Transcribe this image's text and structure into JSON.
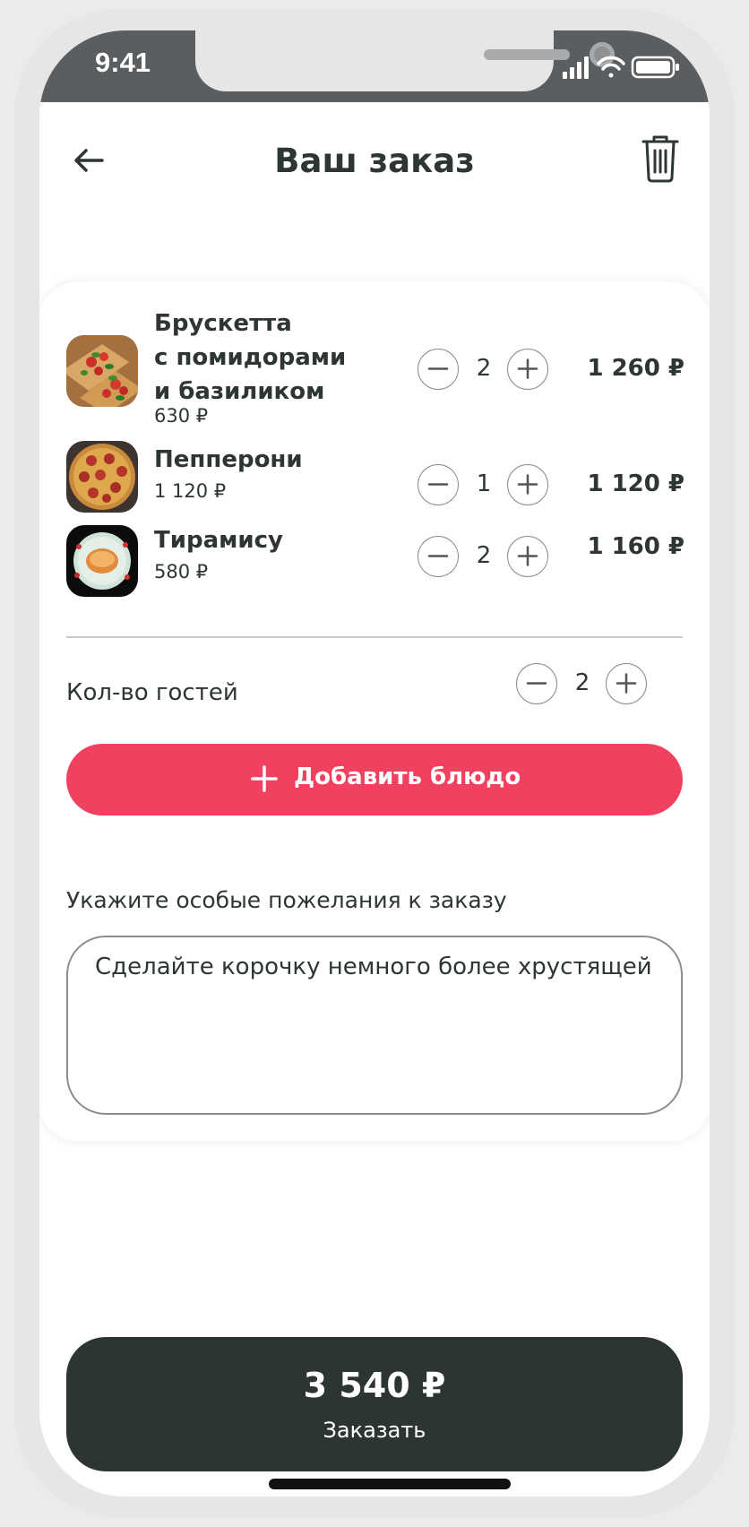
{
  "status_bar": {
    "time": "9:41",
    "icons": [
      "signal-icon",
      "wifi-icon",
      "battery-icon"
    ]
  },
  "header": {
    "title": "Ваш заказ",
    "back_icon": "arrow-left-icon",
    "trash_icon": "trash-icon"
  },
  "order_items": [
    {
      "name_lines": [
        "Брускетта",
        "с помидорами",
        "и базиликом"
      ],
      "unit_price": "630 ₽",
      "quantity": "2",
      "total": "1 260 ₽",
      "image": "bruschetta-image"
    },
    {
      "name_lines": [
        "Пепперони"
      ],
      "unit_price": "1 120 ₽",
      "quantity": "1",
      "total": "1 120 ₽",
      "image": "pepperoni-pizza-image"
    },
    {
      "name_lines": [
        "Тирамису"
      ],
      "unit_price": "580 ₽",
      "quantity": "2",
      "total": "1 160 ₽",
      "image": "tiramisu-image"
    }
  ],
  "guests": {
    "label": "Кол-во гостей",
    "count": "2"
  },
  "add_dish": {
    "label": "Добавить блюдо"
  },
  "wishes": {
    "label": "Укажите особые пожелания к заказу",
    "value": "Сделайте корочку немного более хрустящей"
  },
  "order_button": {
    "total": "3 540 ₽",
    "label": "Заказать"
  },
  "colors": {
    "accent": "#f24160",
    "dark": "#2c352f",
    "text": "#2d3630",
    "status_bar": "#5b5e60"
  }
}
